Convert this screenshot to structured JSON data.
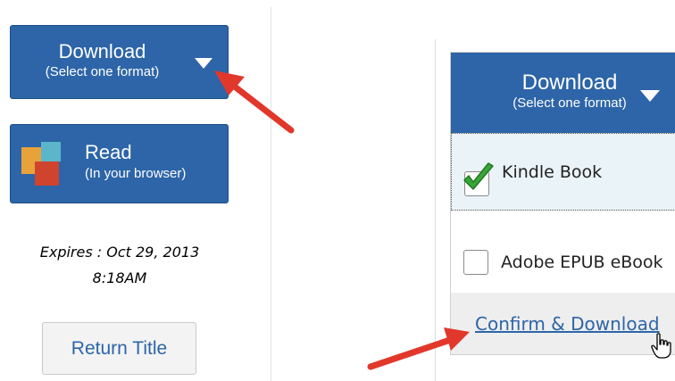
{
  "left_panel": {
    "download_button": {
      "title": "Download",
      "subtitle": "(Select one format)"
    },
    "read_button": {
      "title": "Read",
      "subtitle": "(In your browser)"
    },
    "expires": {
      "line1": "Expires :  Oct 29, 2013",
      "line2": "8:18AM"
    },
    "return_button": "Return Title"
  },
  "right_panel": {
    "download_header": {
      "title": "Download",
      "subtitle": "(Select one format)"
    },
    "options": [
      {
        "label": "Kindle Book",
        "checked": true
      },
      {
        "label": "Adobe EPUB eBook",
        "checked": false
      }
    ],
    "confirm_link": "Confirm & Download"
  },
  "colors": {
    "button_blue": "#2d65a8",
    "annotation_arrow": "#e2372b",
    "checkmark_green": "#3aa53a",
    "selected_row_bg": "#eaf3f7"
  }
}
